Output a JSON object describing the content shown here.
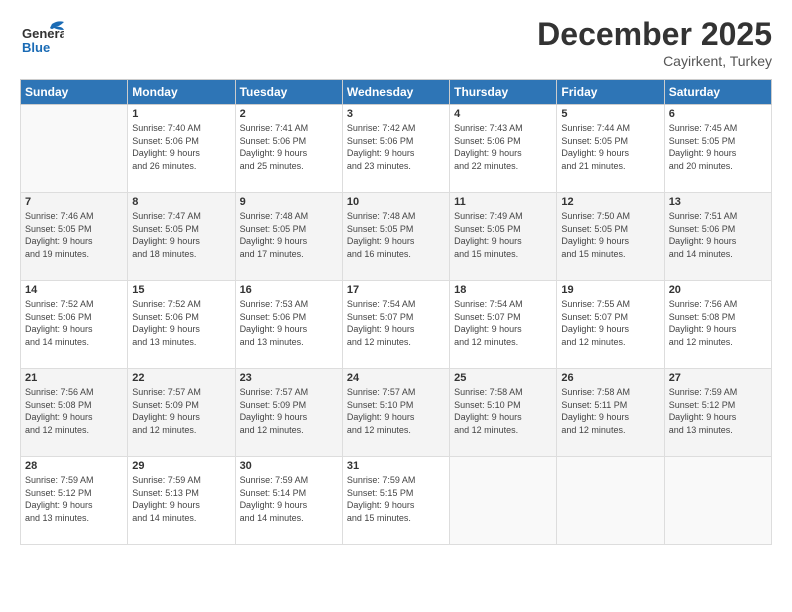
{
  "logo": {
    "text_general": "General",
    "text_blue": "Blue"
  },
  "title": "December 2025",
  "location": "Cayirkent, Turkey",
  "days_header": [
    "Sunday",
    "Monday",
    "Tuesday",
    "Wednesday",
    "Thursday",
    "Friday",
    "Saturday"
  ],
  "weeks": [
    {
      "days": [
        {
          "num": "",
          "info": ""
        },
        {
          "num": "1",
          "info": "Sunrise: 7:40 AM\nSunset: 5:06 PM\nDaylight: 9 hours\nand 26 minutes."
        },
        {
          "num": "2",
          "info": "Sunrise: 7:41 AM\nSunset: 5:06 PM\nDaylight: 9 hours\nand 25 minutes."
        },
        {
          "num": "3",
          "info": "Sunrise: 7:42 AM\nSunset: 5:06 PM\nDaylight: 9 hours\nand 23 minutes."
        },
        {
          "num": "4",
          "info": "Sunrise: 7:43 AM\nSunset: 5:06 PM\nDaylight: 9 hours\nand 22 minutes."
        },
        {
          "num": "5",
          "info": "Sunrise: 7:44 AM\nSunset: 5:05 PM\nDaylight: 9 hours\nand 21 minutes."
        },
        {
          "num": "6",
          "info": "Sunrise: 7:45 AM\nSunset: 5:05 PM\nDaylight: 9 hours\nand 20 minutes."
        }
      ]
    },
    {
      "days": [
        {
          "num": "7",
          "info": "Sunrise: 7:46 AM\nSunset: 5:05 PM\nDaylight: 9 hours\nand 19 minutes."
        },
        {
          "num": "8",
          "info": "Sunrise: 7:47 AM\nSunset: 5:05 PM\nDaylight: 9 hours\nand 18 minutes."
        },
        {
          "num": "9",
          "info": "Sunrise: 7:48 AM\nSunset: 5:05 PM\nDaylight: 9 hours\nand 17 minutes."
        },
        {
          "num": "10",
          "info": "Sunrise: 7:48 AM\nSunset: 5:05 PM\nDaylight: 9 hours\nand 16 minutes."
        },
        {
          "num": "11",
          "info": "Sunrise: 7:49 AM\nSunset: 5:05 PM\nDaylight: 9 hours\nand 15 minutes."
        },
        {
          "num": "12",
          "info": "Sunrise: 7:50 AM\nSunset: 5:05 PM\nDaylight: 9 hours\nand 15 minutes."
        },
        {
          "num": "13",
          "info": "Sunrise: 7:51 AM\nSunset: 5:06 PM\nDaylight: 9 hours\nand 14 minutes."
        }
      ]
    },
    {
      "days": [
        {
          "num": "14",
          "info": "Sunrise: 7:52 AM\nSunset: 5:06 PM\nDaylight: 9 hours\nand 14 minutes."
        },
        {
          "num": "15",
          "info": "Sunrise: 7:52 AM\nSunset: 5:06 PM\nDaylight: 9 hours\nand 13 minutes."
        },
        {
          "num": "16",
          "info": "Sunrise: 7:53 AM\nSunset: 5:06 PM\nDaylight: 9 hours\nand 13 minutes."
        },
        {
          "num": "17",
          "info": "Sunrise: 7:54 AM\nSunset: 5:07 PM\nDaylight: 9 hours\nand 12 minutes."
        },
        {
          "num": "18",
          "info": "Sunrise: 7:54 AM\nSunset: 5:07 PM\nDaylight: 9 hours\nand 12 minutes."
        },
        {
          "num": "19",
          "info": "Sunrise: 7:55 AM\nSunset: 5:07 PM\nDaylight: 9 hours\nand 12 minutes."
        },
        {
          "num": "20",
          "info": "Sunrise: 7:56 AM\nSunset: 5:08 PM\nDaylight: 9 hours\nand 12 minutes."
        }
      ]
    },
    {
      "days": [
        {
          "num": "21",
          "info": "Sunrise: 7:56 AM\nSunset: 5:08 PM\nDaylight: 9 hours\nand 12 minutes."
        },
        {
          "num": "22",
          "info": "Sunrise: 7:57 AM\nSunset: 5:09 PM\nDaylight: 9 hours\nand 12 minutes."
        },
        {
          "num": "23",
          "info": "Sunrise: 7:57 AM\nSunset: 5:09 PM\nDaylight: 9 hours\nand 12 minutes."
        },
        {
          "num": "24",
          "info": "Sunrise: 7:57 AM\nSunset: 5:10 PM\nDaylight: 9 hours\nand 12 minutes."
        },
        {
          "num": "25",
          "info": "Sunrise: 7:58 AM\nSunset: 5:10 PM\nDaylight: 9 hours\nand 12 minutes."
        },
        {
          "num": "26",
          "info": "Sunrise: 7:58 AM\nSunset: 5:11 PM\nDaylight: 9 hours\nand 12 minutes."
        },
        {
          "num": "27",
          "info": "Sunrise: 7:59 AM\nSunset: 5:12 PM\nDaylight: 9 hours\nand 13 minutes."
        }
      ]
    },
    {
      "days": [
        {
          "num": "28",
          "info": "Sunrise: 7:59 AM\nSunset: 5:12 PM\nDaylight: 9 hours\nand 13 minutes."
        },
        {
          "num": "29",
          "info": "Sunrise: 7:59 AM\nSunset: 5:13 PM\nDaylight: 9 hours\nand 14 minutes."
        },
        {
          "num": "30",
          "info": "Sunrise: 7:59 AM\nSunset: 5:14 PM\nDaylight: 9 hours\nand 14 minutes."
        },
        {
          "num": "31",
          "info": "Sunrise: 7:59 AM\nSunset: 5:15 PM\nDaylight: 9 hours\nand 15 minutes."
        },
        {
          "num": "",
          "info": ""
        },
        {
          "num": "",
          "info": ""
        },
        {
          "num": "",
          "info": ""
        }
      ]
    }
  ]
}
